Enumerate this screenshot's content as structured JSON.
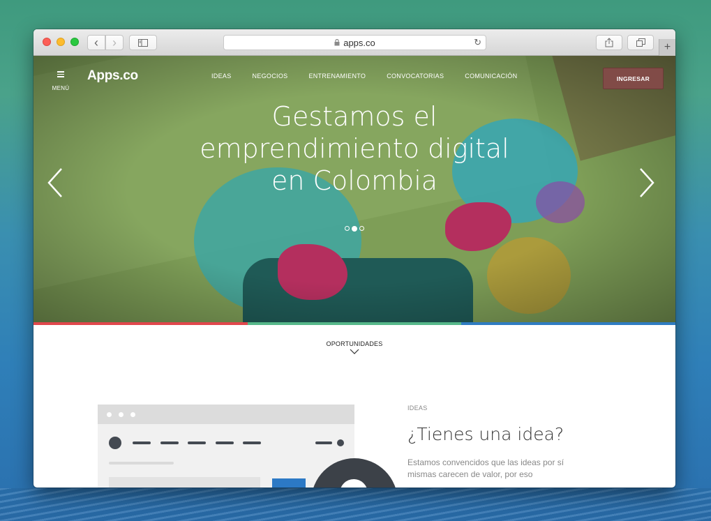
{
  "browser": {
    "url": "apps.co",
    "back_icon": "‹",
    "forward_icon": "›",
    "reload_icon": "↻",
    "lock_icon": "🔒",
    "new_tab_icon": "+"
  },
  "site": {
    "menu_label": "MENÚ",
    "logo": "Apps.co",
    "nav": [
      "IDEAS",
      "NEGOCIOS",
      "ENTRENAMIENTO",
      "CONVOCATORIAS",
      "COMUNICACIÓN"
    ],
    "login_label": "INGRESAR"
  },
  "hero": {
    "title_lines": [
      "Gestamos el",
      "emprendimiento digital",
      "en Colombia"
    ],
    "slides": 3,
    "active_slide": 2
  },
  "strip_colors": [
    "#e0474c",
    "#56b88a",
    "#2f7cc1"
  ],
  "opportunities": {
    "label": "OPORTUNIDADES"
  },
  "ideas": {
    "tag": "IDEAS",
    "title": "¿Tienes una idea?",
    "text": "Estamos convencidos que las ideas por sí mismas carecen de valor, por eso"
  }
}
